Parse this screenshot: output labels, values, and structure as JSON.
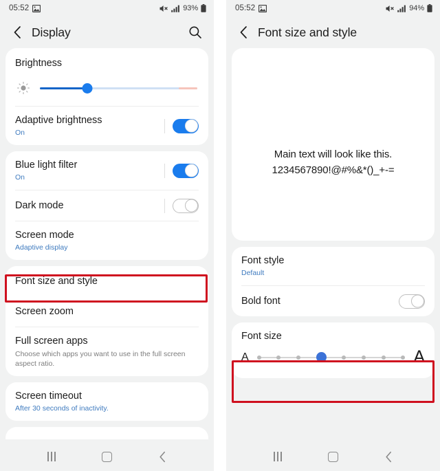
{
  "left_screen": {
    "status_bar": {
      "time": "05:52",
      "image_icon": "image-icon",
      "mute_icon": "mute-icon",
      "signal_icon": "signal-bars-icon",
      "battery_percent": "93%",
      "battery_icon": "battery-icon"
    },
    "app_bar": {
      "back_icon": "back-chevron-icon",
      "title": "Display",
      "search_icon": "search-icon"
    },
    "brightness": {
      "title": "Brightness",
      "sun_icon": "brightness-sun-icon",
      "slider_value_percent": 30,
      "fill_color": "#1565c8",
      "track_color": "#cfe0f4",
      "tail_color": "#f6c4bb"
    },
    "adaptive_brightness": {
      "title": "Adaptive brightness",
      "subtitle": "On",
      "toggle_state": "on"
    },
    "blue_light_filter": {
      "title": "Blue light filter",
      "subtitle": "On",
      "toggle_state": "on"
    },
    "dark_mode": {
      "title": "Dark mode",
      "toggle_state": "off"
    },
    "screen_mode": {
      "title": "Screen mode",
      "subtitle": "Adaptive display"
    },
    "font_size_and_style": {
      "title": "Font size and style",
      "highlighted": true
    },
    "screen_zoom": {
      "title": "Screen zoom"
    },
    "full_screen_apps": {
      "title": "Full screen apps",
      "subtitle": "Choose which apps you want to use in the full screen aspect ratio."
    },
    "screen_timeout": {
      "title": "Screen timeout",
      "subtitle": "After 30 seconds of inactivity."
    },
    "nav_bar": {
      "recents_icon": "recents-icon",
      "home_icon": "home-icon",
      "back_icon": "back-chevron-icon"
    }
  },
  "right_screen": {
    "status_bar": {
      "time": "05:52",
      "image_icon": "image-icon",
      "mute_icon": "mute-icon",
      "signal_icon": "signal-bars-icon",
      "battery_percent": "94%",
      "battery_icon": "battery-icon"
    },
    "app_bar": {
      "back_icon": "back-chevron-icon",
      "title": "Font size and style"
    },
    "preview": {
      "line1": "Main text will look like this.",
      "line2": "1234567890!@#%&*()_+-="
    },
    "font_style": {
      "title": "Font style",
      "subtitle": "Default"
    },
    "bold_font": {
      "title": "Bold font",
      "toggle_state": "off"
    },
    "font_size": {
      "title": "Font size",
      "highlighted": true,
      "small_label": "A",
      "large_label": "A",
      "steps": 8,
      "selected_step": 4,
      "active_color": "#3c72d7",
      "tick_color": "#b9b9b9"
    },
    "nav_bar": {
      "recents_icon": "recents-icon",
      "home_icon": "home-icon",
      "back_icon": "back-chevron-icon"
    }
  },
  "highlight_color": "#cf101f"
}
